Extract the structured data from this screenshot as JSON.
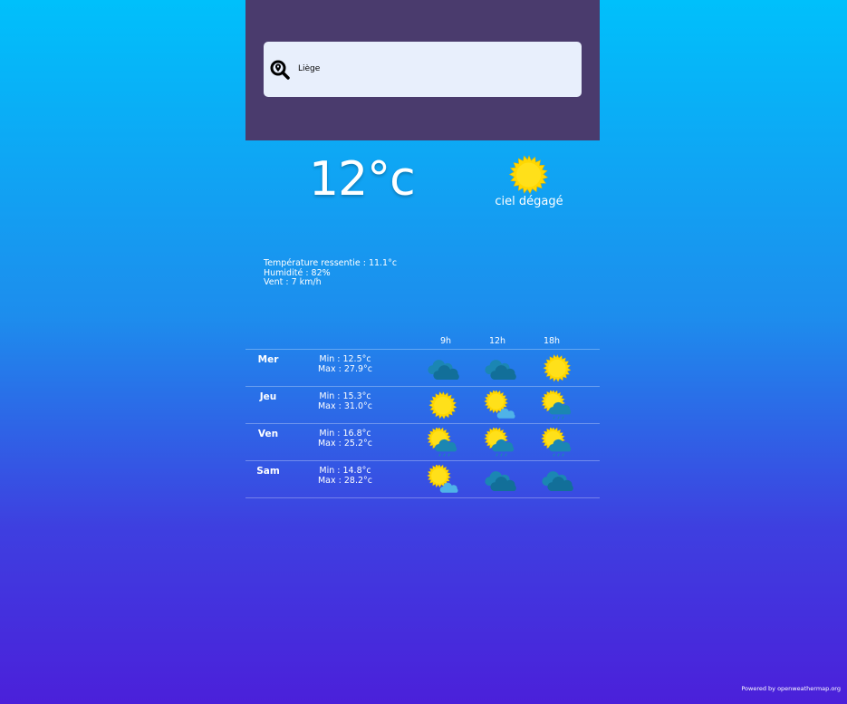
{
  "search": {
    "value": "Liège",
    "icon": "location-search-icon"
  },
  "current": {
    "temperature": "12°c",
    "icon": "sun-icon",
    "description": "ciel dégagé"
  },
  "details": {
    "feels_like": "Température ressentie : 11.1°c",
    "humidity": "Humidité : 82%",
    "wind": "Vent : 7 km/h"
  },
  "forecast": {
    "hours": [
      "9h",
      "12h",
      "18h"
    ],
    "days": [
      {
        "name": "Mer",
        "min": "Min : 12.5°c",
        "max": "Max : 27.9°c",
        "icons": [
          "clouds-icon",
          "clouds-icon",
          "sun-icon"
        ]
      },
      {
        "name": "Jeu",
        "min": "Min : 15.3°c",
        "max": "Max : 31.0°c",
        "icons": [
          "sun-icon",
          "sun-cloud-icon",
          "sun-rain-icon"
        ]
      },
      {
        "name": "Ven",
        "min": "Min : 16.8°c",
        "max": "Max : 25.2°c",
        "icons": [
          "sun-rain-icon",
          "sun-rain-icon",
          "sun-rain-icon"
        ]
      },
      {
        "name": "Sam",
        "min": "Min : 14.8°c",
        "max": "Max : 28.2°c",
        "icons": [
          "sun-cloud-icon",
          "clouds-icon",
          "clouds-icon"
        ]
      }
    ]
  },
  "footer": {
    "powered": "Powered by openweathermap.org"
  },
  "colors": {
    "header_bg": "#4a3b6d",
    "search_bg": "#e8effc",
    "gradient_top": "#00c0fb",
    "gradient_bottom": "#4b20da",
    "sun": "#ffd700",
    "cloud": "#1c8fb5"
  }
}
